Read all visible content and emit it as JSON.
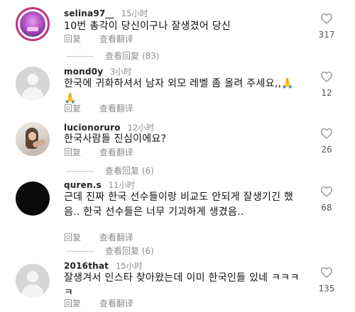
{
  "comments": [
    {
      "username": "selina97__",
      "time": "15小时",
      "text": "10번 총각이 당신이구나 잘생겼어 당신",
      "reply": "回复",
      "translate": "查看翻译",
      "likes": "317",
      "replies_label": "查看回复 (83)"
    },
    {
      "username": "mond0y",
      "time": "3小时",
      "text": "한국에 귀화하셔서 남자 외모 레벨 좀 올려 주세요,,🙏🙏",
      "reply": "回复",
      "translate": "查看翻译",
      "likes": "12",
      "replies_label": ""
    },
    {
      "username": "lucionoruro",
      "time": "12小时",
      "text": "한국사람들 진심이에요?",
      "reply": "回复",
      "translate": "查看翻译",
      "likes": "26",
      "replies_label": "查看回复 (6)"
    },
    {
      "username": "quren.s",
      "time": "11小时",
      "text": "근데 진짜 한국 선수들이랑 비교도 안되게 잘생기긴 했음.. 한국 선수들은 너무 기괴하게 생겼음..",
      "reply": "回复",
      "translate": "查看翻译",
      "likes": "68",
      "replies_label": "查看回复 (6)"
    },
    {
      "username": "2016that",
      "time": "15小时",
      "text": "잘생겨서 인스타 찾아왔는데 이미 한국인들 있네 ㅋㅋㅋㅋ",
      "reply": "回复",
      "translate": "查看翻译",
      "likes": "135",
      "replies_label": ""
    }
  ],
  "icons": {
    "like": "heart-outline-icon",
    "accent": "#c13584"
  }
}
